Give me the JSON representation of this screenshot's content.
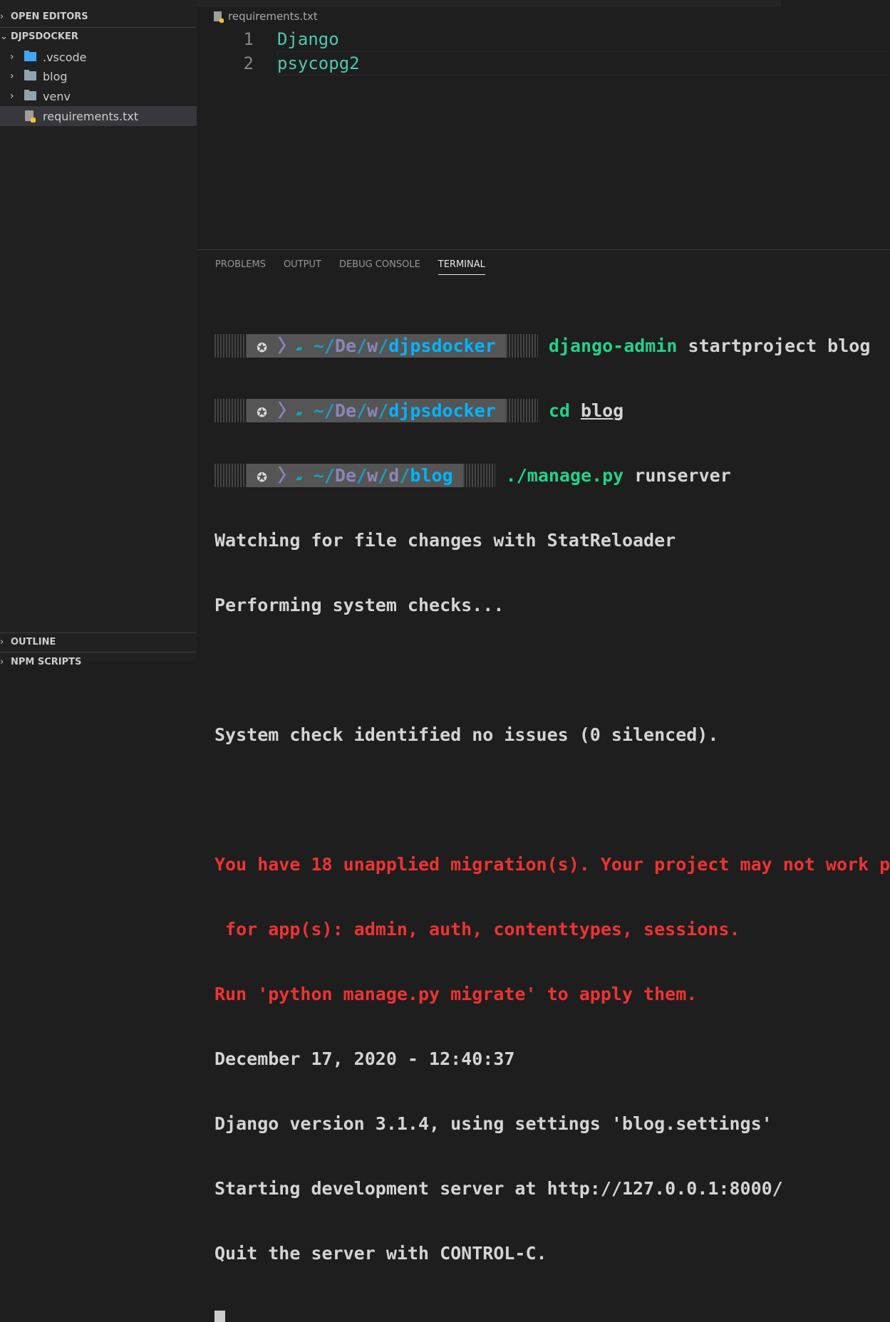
{
  "sidebar": {
    "open_editors": "OPEN EDITORS",
    "project": "DJPSDOCKER",
    "items": [
      {
        "label": ".vscode",
        "icon": "vscode-folder-icon"
      },
      {
        "label": "blog",
        "icon": "folder-icon"
      },
      {
        "label": "venv",
        "icon": "folder-icon"
      },
      {
        "label": "requirements.txt",
        "icon": "python-requirements-file-icon",
        "selected": true
      }
    ],
    "outline": "OUTLINE",
    "npm_scripts": "NPM SCRIPTS"
  },
  "editor": {
    "breadcrumb": "requirements.txt",
    "lines": [
      {
        "num": "1",
        "text": "Django"
      },
      {
        "num": "2",
        "text": "psycopg2"
      }
    ]
  },
  "panel": {
    "tabs": [
      "PROBLEMS",
      "OUTPUT",
      "DEBUG CONSOLE",
      "TERMINAL"
    ],
    "active_tab": "TERMINAL"
  },
  "terminal": {
    "prompts": [
      {
        "tilde": "~",
        "p1": "De",
        "p2": "w",
        "dir": "djpsdocker",
        "cmd": "django-admin",
        "args": " startproject blog"
      },
      {
        "tilde": "~",
        "p1": "De",
        "p2": "w",
        "dir": "djpsdocker",
        "cmd": "cd",
        "args": "blog"
      },
      {
        "tilde": "~",
        "p1": "De",
        "p2": "w",
        "p3": "d",
        "dir": "blog",
        "cmd": "./manage.py",
        "args": " runserver"
      }
    ],
    "output": [
      "Watching for file changes with StatReloader",
      "Performing system checks...",
      "",
      "System check identified no issues (0 silenced).",
      ""
    ],
    "warning": [
      "You have 18 unapplied migration(s). Your project may not work p",
      " for app(s): admin, auth, contenttypes, sessions.",
      "Run 'python manage.py migrate' to apply them."
    ],
    "output2": [
      "December 17, 2020 - 12:40:37",
      "Django version 3.1.4, using settings 'blog.settings'",
      "Starting development server at http://127.0.0.1:8000/",
      "Quit the server with CONTROL-C."
    ]
  }
}
